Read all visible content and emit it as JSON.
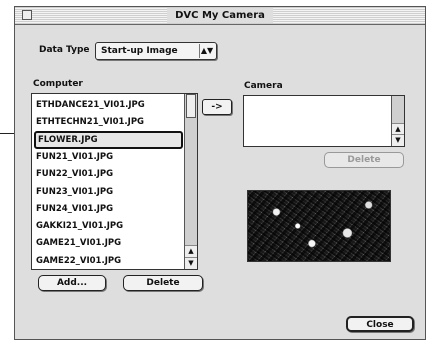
{
  "window": {
    "title": "DVC My Camera"
  },
  "data_type": {
    "label": "Data Type",
    "selected": "Start-up Image"
  },
  "computer": {
    "label": "Computer",
    "files": [
      "ETHDANCE21_VI01.JPG",
      "ETHTECHN21_VI01.JPG",
      "FLOWER.JPG",
      "FUN21_VI01.JPG",
      "FUN22_VI01.JPG",
      "FUN23_VI01.JPG",
      "FUN24_VI01.JPG",
      "GAKKI21_VI01.JPG",
      "GAME21_VI01.JPG",
      "GAME22_VI01.JPG"
    ],
    "selected_index": 2,
    "add_label": "Add...",
    "delete_label": "Delete"
  },
  "transfer_label": "->",
  "camera": {
    "label": "Camera",
    "files": [],
    "delete_label": "Delete"
  },
  "close_label": "Close",
  "icons": {
    "popup_arrows": "updown-arrows-icon",
    "scroll_up": "scroll-up-arrow-icon",
    "scroll_down": "scroll-down-arrow-icon"
  }
}
